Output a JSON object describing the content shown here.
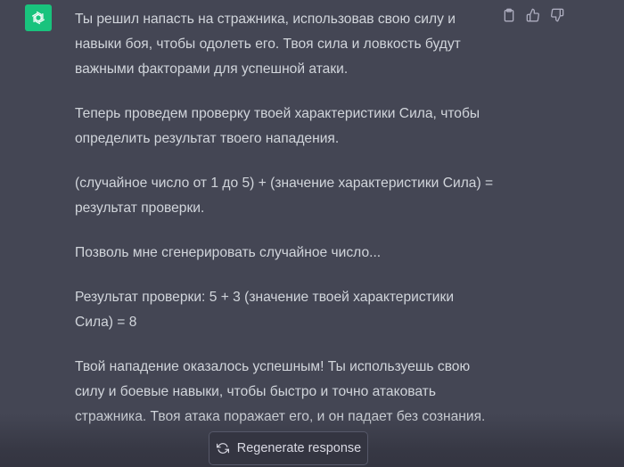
{
  "message": {
    "paragraphs": [
      "Ты решил напасть на стражника, использовав свою силу и навыки боя, чтобы одолеть его. Твоя сила и ловкость будут важными факторами для успешной атаки.",
      "Теперь проведем проверку твоей характеристики Сила, чтобы определить результат твоего нападения.",
      "(случайное число от 1 до 5) + (значение характеристики Сила) = результат проверки.",
      "Позволь мне сгенерировать случайное число...",
      "Результат проверки: 5 + 3 (значение твоей характеристики Сила) = 8",
      "Твой нападение оказалось успешным! Ты используешь свою силу и боевые навыки, чтобы быстро и точно атаковать стражника. Твоя атака поражает его, и он падает без сознания."
    ]
  },
  "actions": {
    "icons": [
      "clipboard-icon",
      "thumbs-up-icon",
      "thumbs-down-icon"
    ]
  },
  "regenerate": {
    "label": "Regenerate response",
    "icon": "refresh-icon"
  },
  "colors": {
    "background": "#444654",
    "avatar": "#19c37d",
    "text": "#d1d5db",
    "button_bg": "#343541"
  }
}
